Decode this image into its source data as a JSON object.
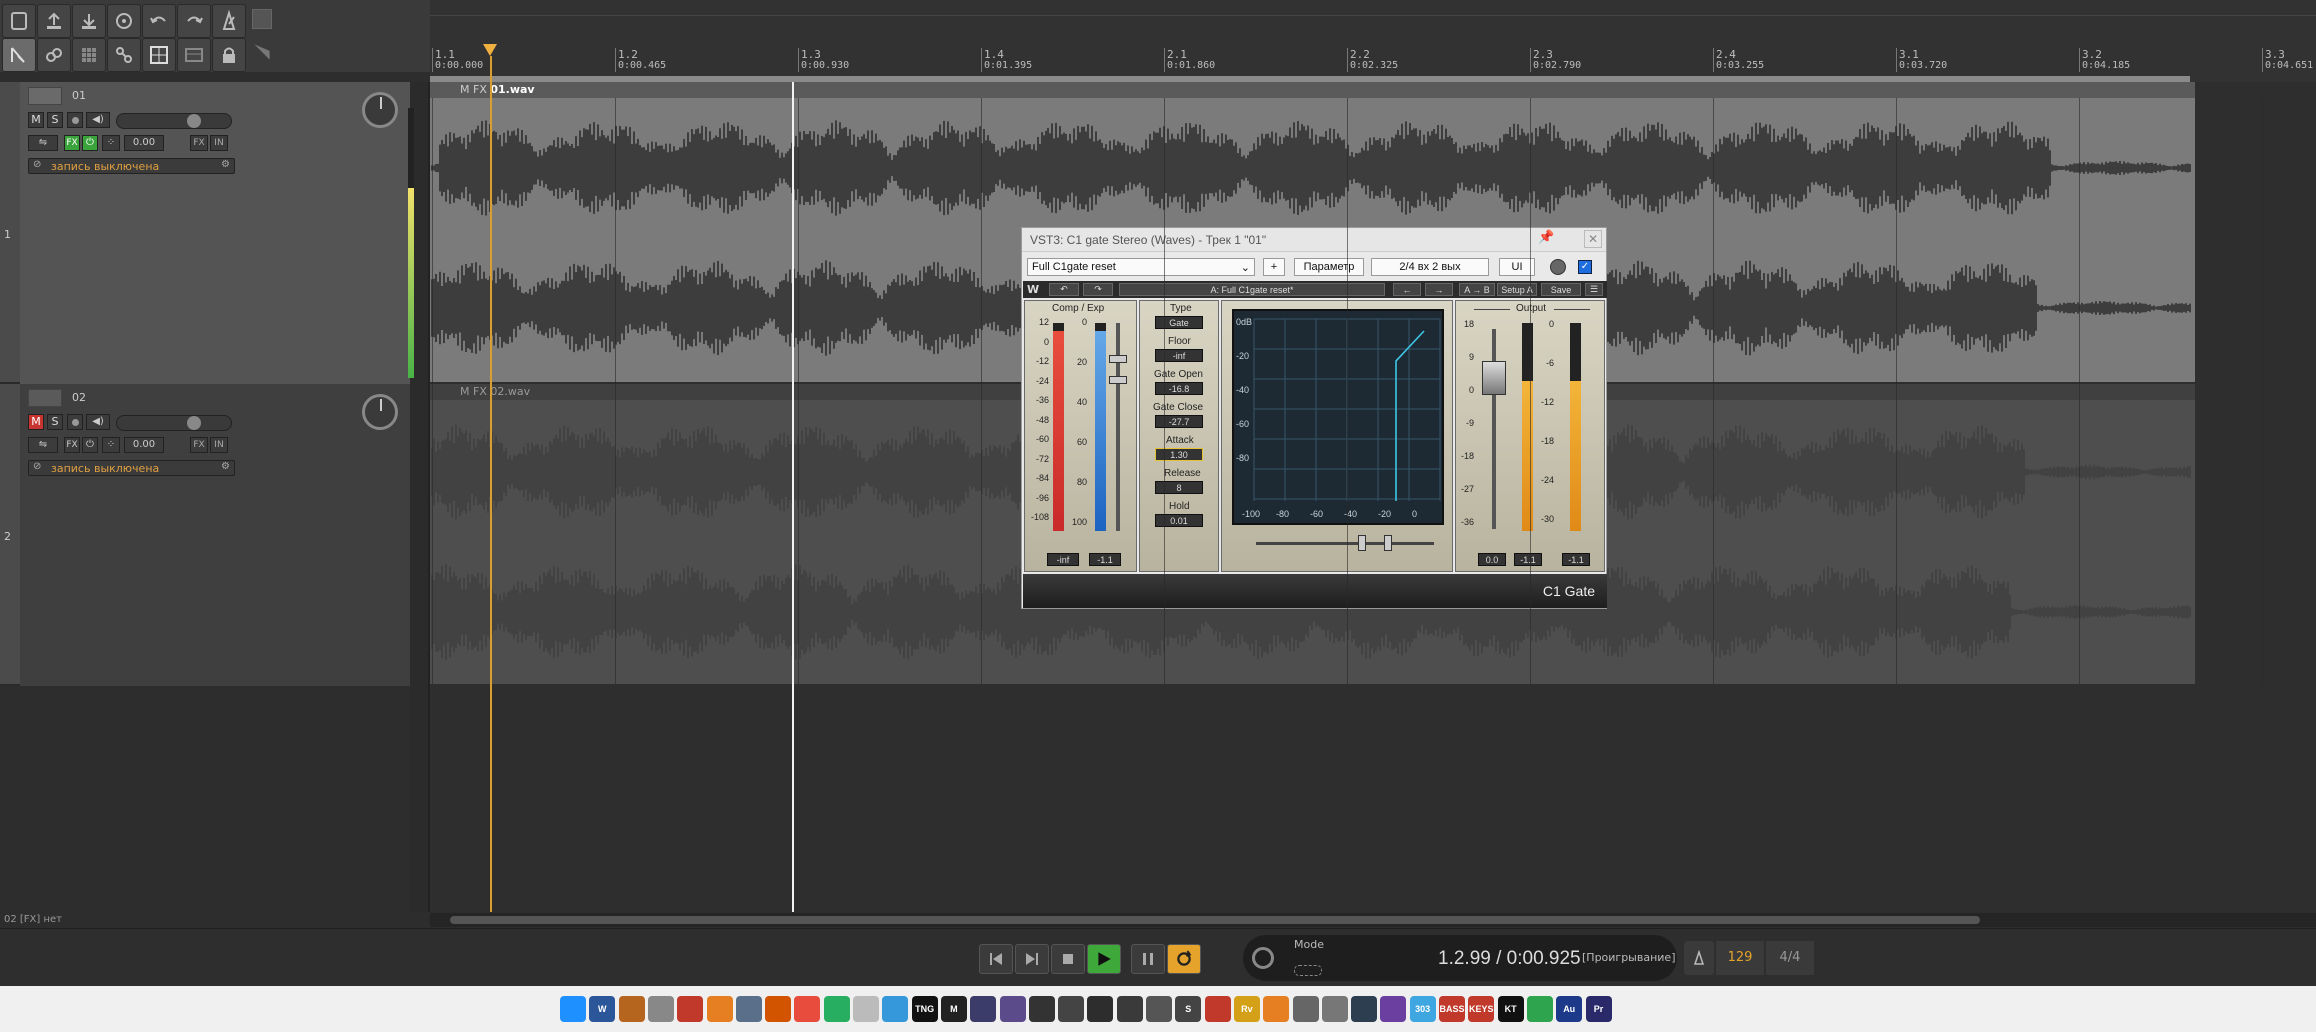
{
  "toolbar": {
    "icons": [
      "folder-icon",
      "upload-icon",
      "download-icon",
      "save-icon",
      "undo-icon",
      "redo-icon",
      "metronome-icon",
      "blank-icon",
      "cursor-tool-icon",
      "link-icon",
      "grid-icon",
      "group-icon",
      "snap-grid-icon",
      "table-icon",
      "lock-icon",
      "pencil-icon"
    ]
  },
  "tracks": [
    {
      "number": "01",
      "row": "1",
      "volume": "0.00",
      "fx": "FX",
      "in": "IN",
      "mute": "M",
      "solo": "S",
      "record_status": "запись выключена",
      "clip_name": "01.wav",
      "clip_prefix": "M FX"
    },
    {
      "number": "02",
      "row": "2",
      "volume": "0.00",
      "fx": "FX",
      "in": "IN",
      "mute": "M",
      "solo": "S",
      "record_status": "запись выключена",
      "clip_name": "02.wav",
      "clip_prefix": "M FX"
    }
  ],
  "ruler": {
    "bars": [
      "1.1",
      "1.2",
      "1.3",
      "1.4",
      "2.1",
      "2.2",
      "2.3",
      "2.4",
      "3.1",
      "3.2",
      "3.3"
    ],
    "times": [
      "0:00.000",
      "0:00.465",
      "0:00.930",
      "0:01.395",
      "0:01.860",
      "0:02.325",
      "0:02.790",
      "0:03.255",
      "0:03.720",
      "0:04.185",
      "0:04.651"
    ]
  },
  "status_bar": {
    "text": "02 [FX] нет"
  },
  "plugin": {
    "title": "VST3: C1 gate Stereo (Waves) - Трек 1 \"01\"",
    "preset": "Full C1gate reset",
    "plus": "+",
    "param": "Параметр",
    "io": "2/4 вх 2 вых",
    "ui": "UI",
    "waves_preset": "A: Full C1gate reset*",
    "ab": "A → B",
    "setup": "Setup A",
    "save": "Save",
    "left_title": "Comp / Exp",
    "left_scale": [
      "12",
      "0",
      "-12",
      "-24",
      "-36",
      "-48",
      "-60",
      "-72",
      "-84",
      "-96",
      "-108"
    ],
    "right_scale_left": [
      "0",
      "20",
      "40",
      "60",
      "80",
      "100"
    ],
    "left_vals": [
      "-inf",
      "-1.1"
    ],
    "type_label": "Type",
    "type_value": "Gate",
    "floor_label": "Floor",
    "floor_value": "-inf",
    "gate_open_label": "Gate Open",
    "gate_open_value": "-16.8",
    "gate_close_label": "Gate Close",
    "gate_close_value": "-27.7",
    "attack_label": "Attack",
    "attack_value": "1.30",
    "release_label": "Release",
    "release_value": "8",
    "hold_label": "Hold",
    "hold_value": "0.01",
    "graph_y": [
      "0dB",
      "-20",
      "-40",
      "-60",
      "-80"
    ],
    "graph_x": [
      "-100",
      "-80",
      "-60",
      "-40",
      "-20",
      "0"
    ],
    "output_title": "Output",
    "out_scale_left": [
      "18",
      "9",
      "0",
      "-9",
      "-18",
      "-27",
      "-36"
    ],
    "out_scale_right": [
      "0",
      "-6",
      "-12",
      "-18",
      "-24",
      "-30"
    ],
    "output_vals": [
      "0.0",
      "-1.1",
      "-1.1"
    ],
    "plugin_name": "C1 Gate"
  },
  "transport": {
    "mode_label": "Mode",
    "position": "1.2.99 / 0:00.925",
    "state": "[Проигрывание]",
    "tempo": "129",
    "signature": "4/4"
  },
  "taskbar": {
    "icons": [
      "windows-start-icon",
      "word-icon",
      "app-icon",
      "mic-icon",
      "app-icon",
      "search-app-icon",
      "app-icon",
      "app-icon",
      "app-icon",
      "app-icon",
      "app-icon",
      "shield-icon",
      "app-icon",
      "app-icon",
      "app-icon",
      "app-icon",
      "app-icon",
      "app-icon",
      "app-icon",
      "app-icon",
      "app-icon",
      "app-icon",
      "app-icon",
      "app-icon",
      "app-icon",
      "app-icon",
      "app-icon",
      "app-icon",
      "app-icon",
      "app-icon",
      "app-icon",
      "app-icon",
      "app-icon",
      "app-icon",
      "app-icon",
      "app-icon",
      "app-icon",
      "audition-icon",
      "premiere-icon"
    ],
    "labels": [
      "",
      "W",
      "",
      "",
      "",
      "",
      "",
      "",
      "",
      "",
      "",
      "",
      "TNG",
      "M",
      "",
      "",
      "",
      "",
      "",
      "",
      "",
      "S",
      "",
      "Rv",
      "",
      "",
      "",
      "",
      "",
      "303",
      "BASS",
      "KEYS",
      "KT",
      "",
      "Au",
      "Pr"
    ]
  }
}
